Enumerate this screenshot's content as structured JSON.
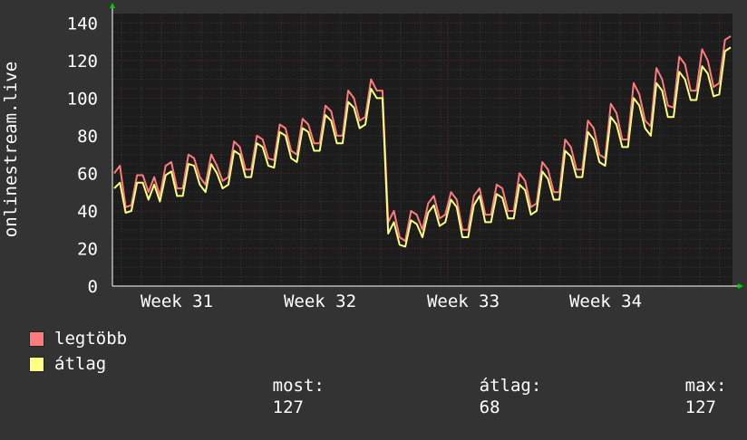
{
  "chart_data": {
    "type": "line",
    "ylabel": "onlinestream.live",
    "x_tick_labels": [
      "Week 31",
      "Week 32",
      "Week 33",
      "Week 34"
    ],
    "y_ticks": [
      0,
      20,
      40,
      60,
      80,
      100,
      120,
      140
    ],
    "ylim": [
      0,
      145
    ],
    "grid": true,
    "legend_position": "bottom",
    "colors": {
      "background": "#333333",
      "plot_background": "#1c1c1c",
      "grid_major": "#5a3030",
      "grid_minor": "#3a3a3a",
      "arrow": "#00cc00"
    },
    "series": [
      {
        "name": "legtöbb",
        "color": "#ff7b7b",
        "values": [
          60,
          64,
          42,
          43,
          59,
          59,
          50,
          58,
          48,
          64,
          66,
          52,
          52,
          70,
          68,
          58,
          54,
          70,
          64,
          56,
          58,
          77,
          74,
          62,
          62,
          80,
          78,
          68,
          67,
          86,
          84,
          72,
          70,
          89,
          86,
          76,
          76,
          96,
          93,
          80,
          80,
          104,
          100,
          88,
          90,
          110,
          104,
          104,
          34,
          40,
          26,
          24,
          40,
          38,
          30,
          44,
          48,
          36,
          38,
          50,
          46,
          30,
          30,
          48,
          52,
          38,
          38,
          54,
          52,
          40,
          40,
          60,
          56,
          42,
          44,
          66,
          62,
          50,
          50,
          78,
          74,
          62,
          62,
          88,
          84,
          70,
          68,
          97,
          92,
          78,
          78,
          108,
          102,
          88,
          85,
          116,
          110,
          96,
          95,
          122,
          118,
          104,
          104,
          126,
          120,
          106,
          108,
          131,
          133
        ]
      },
      {
        "name": "átlag",
        "color": "#ffff80",
        "values": [
          52,
          55,
          39,
          40,
          55,
          55,
          46,
          54,
          45,
          59,
          61,
          48,
          48,
          65,
          64,
          54,
          50,
          65,
          60,
          52,
          54,
          72,
          70,
          58,
          58,
          76,
          74,
          64,
          63,
          82,
          80,
          68,
          66,
          84,
          82,
          72,
          72,
          91,
          88,
          76,
          76,
          98,
          95,
          84,
          86,
          105,
          100,
          100,
          28,
          34,
          22,
          21,
          35,
          33,
          26,
          39,
          43,
          32,
          34,
          46,
          42,
          26,
          26,
          43,
          48,
          34,
          34,
          49,
          47,
          36,
          36,
          54,
          51,
          38,
          40,
          61,
          57,
          46,
          46,
          72,
          69,
          58,
          58,
          82,
          78,
          66,
          64,
          90,
          86,
          74,
          74,
          100,
          96,
          84,
          80,
          108,
          104,
          90,
          90,
          114,
          110,
          99,
          99,
          117,
          113,
          101,
          102,
          125,
          127
        ]
      }
    ],
    "legend": {
      "max_label": "legtöbb",
      "avg_label": "átlag",
      "stats": [
        {
          "label": "most:",
          "value": "127"
        },
        {
          "label": "átlag:",
          "value": "68"
        },
        {
          "label": "max:",
          "value": "127"
        }
      ]
    }
  }
}
